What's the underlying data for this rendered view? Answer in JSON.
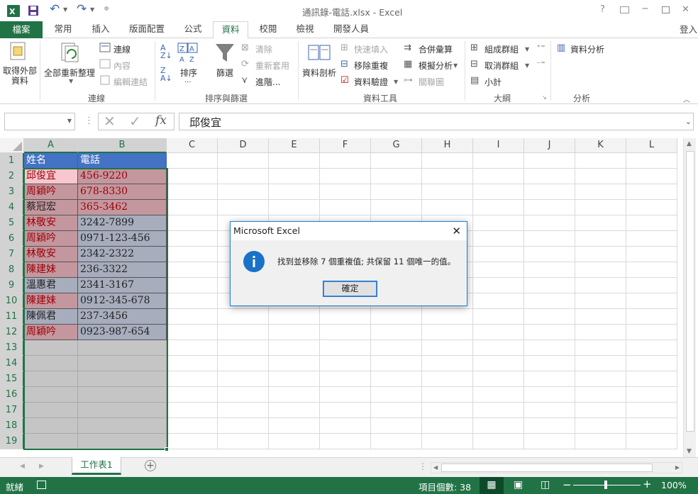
{
  "titlebar": {
    "title": "通訊錄-電話.xlsx - Excel",
    "help": "?",
    "minimize": "−",
    "restore": "□",
    "close": "✕",
    "signin": "登入"
  },
  "tabs": [
    "檔案",
    "常用",
    "插入",
    "版面配置",
    "公式",
    "資料",
    "校閱",
    "檢視",
    "開發人員"
  ],
  "ribbon": {
    "get_external": "取得外部資料",
    "refresh_all": "全部重新整理",
    "connections": "連線",
    "properties": "內容",
    "edit_links": "編輯連結",
    "grp_connections": "連線",
    "sort": "排序",
    "filter": "篩選",
    "clear": "清除",
    "reapply": "重新套用",
    "advanced": "進階...",
    "grp_sort": "排序與篩選",
    "text_to_columns": "資料剖析",
    "flash_fill": "快速填入",
    "remove_dup": "移除重複",
    "data_validation": "資料驗證",
    "consolidate": "合併彙算",
    "what_if": "模擬分析",
    "relationships": "關聯圖",
    "grp_tools": "資料工具",
    "group": "組成群組",
    "ungroup": "取消群組",
    "subtotal": "小計",
    "grp_outline": "大綱",
    "data_analysis": "資料分析",
    "grp_analysis": "分析"
  },
  "formula_bar": {
    "name_box": "",
    "fx": "fx",
    "value": "邱俊宜"
  },
  "columns": [
    "A",
    "B",
    "C",
    "D",
    "E",
    "F",
    "G",
    "H",
    "I",
    "J",
    "K",
    "L"
  ],
  "rows": [
    "1",
    "2",
    "3",
    "4",
    "5",
    "6",
    "7",
    "8",
    "9",
    "10",
    "11",
    "12",
    "13",
    "14",
    "15",
    "16",
    "17",
    "18",
    "19"
  ],
  "table": {
    "header": [
      "姓名",
      "電話"
    ],
    "data": [
      {
        "name": "邱俊宜",
        "phone": "456-9220"
      },
      {
        "name": "周穎吟",
        "phone": "678-8330"
      },
      {
        "name": "蔡冠宏",
        "phone": "365-3462"
      },
      {
        "name": "林敬安",
        "phone": "3242-7899"
      },
      {
        "name": "周穎吟",
        "phone": "0971-123-456"
      },
      {
        "name": "林敬安",
        "phone": "2342-2322"
      },
      {
        "name": "陳建妹",
        "phone": "236-3322"
      },
      {
        "name": "溫惠君",
        "phone": "2341-3167"
      },
      {
        "name": "陳建妹",
        "phone": "0912-345-678"
      },
      {
        "name": "陳佩君",
        "phone": "237-3456"
      },
      {
        "name": "周穎吟",
        "phone": "0923-987-654"
      }
    ]
  },
  "sheet_tab": "工作表1",
  "status": {
    "ready": "就緒",
    "count": "項目個數: 38",
    "zoom": "100%"
  },
  "dialog": {
    "title": "Microsoft Excel",
    "message": "找到並移除 7 個重複值; 共保留 11 個唯一的值。",
    "ok": "確定"
  },
  "colors": {
    "accent": "#217346",
    "header_fill": "#4472c4",
    "dup_fill": "#c4979f",
    "dup_text": "#9c0006",
    "plain_fill": "#a7adbd",
    "empty_fill": "#c5c5c5"
  }
}
